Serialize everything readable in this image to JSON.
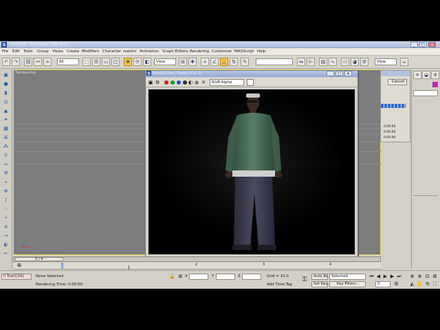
{
  "window": {
    "title": "Untitled - Autodesk 3ds Max",
    "app_icon": "3ds-max-logo-icon",
    "controls": [
      "_",
      "▢",
      "✕"
    ]
  },
  "menu": [
    "File",
    "Edit",
    "Tools",
    "Group",
    "Views",
    "Create",
    "Modifiers",
    "Character",
    "reactor",
    "Animation",
    "Graph Editors",
    "Rendering",
    "Customize",
    "MAXScript",
    "Help"
  ],
  "toolbar": {
    "selection_filter": "All",
    "reference_coord": "View",
    "named_selection": "",
    "view_dropdown_right": "View"
  },
  "viewport": {
    "label": "Perspective"
  },
  "render_window": {
    "title": "Perspective, frame 0 (1:1)",
    "channel_dropdown": "RGB Alpha",
    "color_dots": [
      "#d81e1e",
      "#1e9a1e",
      "#1e4ed8",
      "#333333"
    ]
  },
  "dialog": {
    "cancel_label": "Cancel",
    "readouts": [
      "0:00:00",
      "0:00:00",
      "0:00:00"
    ]
  },
  "timeline": {
    "frame_counter": "0 / 4",
    "ticks": [
      "2",
      "3",
      "4"
    ]
  },
  "status": {
    "selection": "None Selected",
    "rendering_time": "Rendering Time: 0:00:00",
    "x_label": "X",
    "y_label": "Y",
    "z_label": "Z",
    "grid": "Grid = 10,0",
    "add_time_tag": "Add Time Tag",
    "auto_key": "Auto Key",
    "set_key": "Set Key",
    "key_mode": "Selected",
    "key_filters": "Key Filters...",
    "current_frame": "0",
    "maxscript_listener": "ll ToeO(34)"
  },
  "colors": {
    "viewport_bg": "#7d7d7d",
    "active_border": "#e4d64a",
    "render_bg": "#000000",
    "accent_blue": "#2d6bd0"
  }
}
